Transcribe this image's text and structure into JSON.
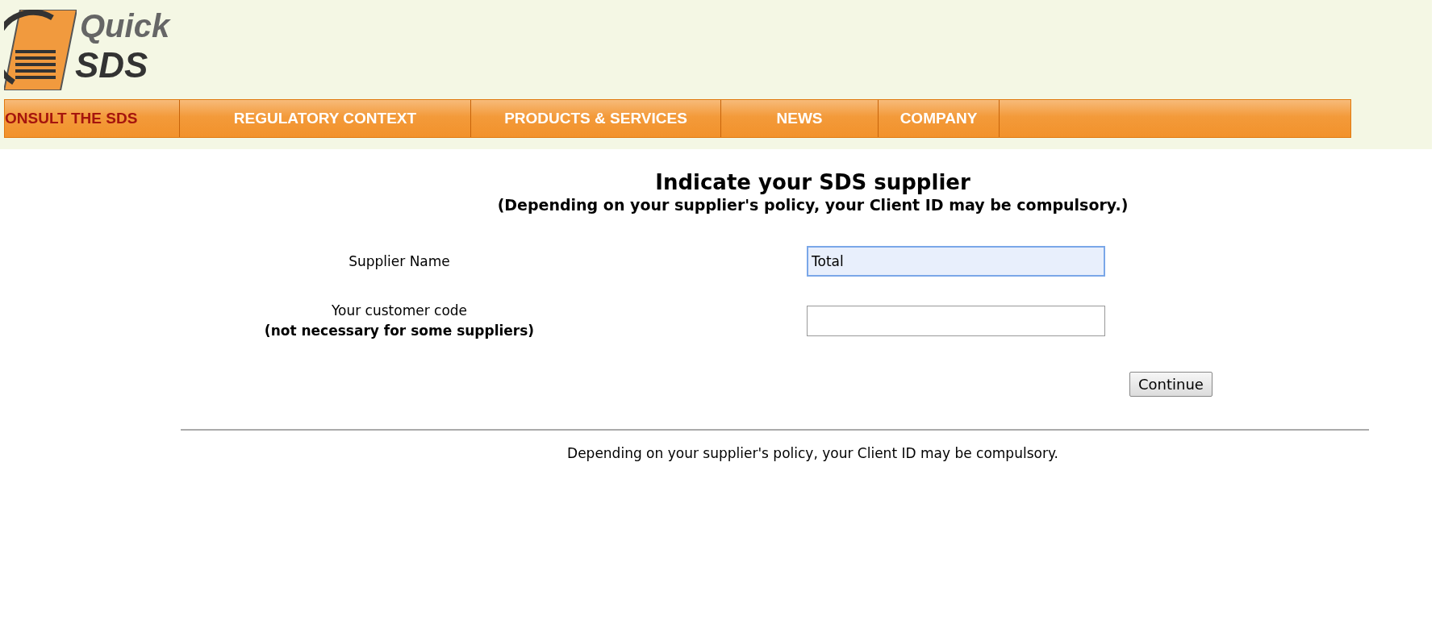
{
  "logo": {
    "word_top": "Quick",
    "word_bottom": "SDS"
  },
  "nav": [
    {
      "label": "ONSULT THE SDS",
      "selected": true
    },
    {
      "label": "REGULATORY CONTEXT",
      "selected": false
    },
    {
      "label": "PRODUCTS & SERVICES",
      "selected": false
    },
    {
      "label": "NEWS",
      "selected": false
    },
    {
      "label": "COMPANY",
      "selected": false
    }
  ],
  "heading": {
    "title": "Indicate your SDS supplier",
    "subtitle": "(Depending on your supplier's policy, your Client ID may be compulsory.)"
  },
  "fields": [
    {
      "label": "Supplier Name",
      "value": "Total",
      "focused": true
    },
    {
      "label": "Your customer code",
      "note": "(not necessary for some suppliers)",
      "focused": false
    }
  ],
  "button": "Continue",
  "footer_note": "Depending on your supplier's policy, your Client ID may be compulsory."
}
